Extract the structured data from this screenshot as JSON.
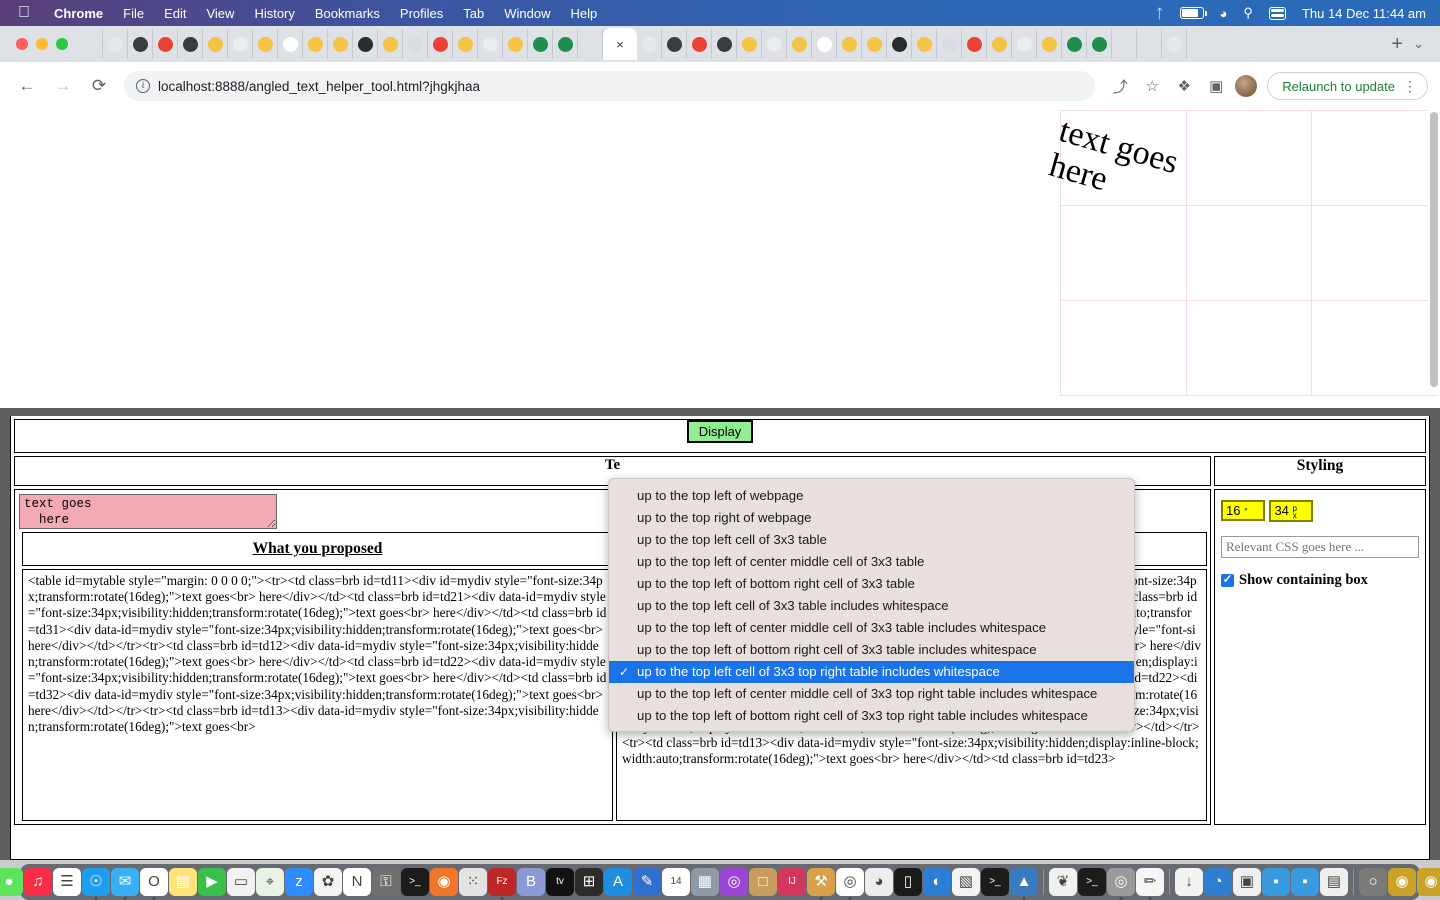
{
  "menubar": {
    "apple_icon": "apple-icon",
    "items": [
      {
        "label": "Chrome",
        "bold": true
      },
      {
        "label": "File",
        "bold": false
      },
      {
        "label": "Edit",
        "bold": false
      },
      {
        "label": "View",
        "bold": false
      },
      {
        "label": "History",
        "bold": false
      },
      {
        "label": "Bookmarks",
        "bold": false
      },
      {
        "label": "Profiles",
        "bold": false
      },
      {
        "label": "Tab",
        "bold": false
      },
      {
        "label": "Window",
        "bold": false
      },
      {
        "label": "Help",
        "bold": false
      }
    ],
    "status_icons": [
      "bluetooth-icon",
      "battery-icon",
      "wifi-icon",
      "search-icon",
      "control-center-icon"
    ],
    "clock": "Thu 14 Dec  11:44 am"
  },
  "browser": {
    "tab_count": 44,
    "active_tab_index": 21,
    "close_label": "×",
    "new_tab_label": "+",
    "tab_list_label": "⌄",
    "back_label": "←",
    "forward_label": "→",
    "reload_label": "⟳",
    "url": "localhost:8888/angled_text_helper_tool.html?jhgkjhaa",
    "url_host": "localhost",
    "url_path": ":8888/angled_text_helper_tool.html?jhgkjhaa",
    "share_label": "⤴",
    "bookmark_label": "☆",
    "extensions_label": "❖",
    "sidepanel_label": "▣",
    "relaunch_label": "Relaunch to update",
    "menu_label": "⋮"
  },
  "page": {
    "rotated_text_line1": "text goes",
    "rotated_text_line2": "here",
    "rotation_deg": 16,
    "font_size_px": 34
  },
  "tool": {
    "display_button": "Display",
    "textarea_value": "text goes\n  here",
    "columns": {
      "proposed": "What you proposed",
      "middle": "Te",
      "styling": "Styling"
    },
    "code_left": "<table id=mytable style=\"margin: 0 0 0 0;\"><tr><td class=brb id=td11><div id=mydiv style=\"font-size:34px;transform:rotate(16deg);\">text goes<br> here</div></td><td class=brb id=td21><div data-id=mydiv style=\"font-size:34px;visibility:hidden;transform:rotate(16deg);\">text goes<br> here</div></td><td class=brb id=td31><div data-id=mydiv style=\"font-size:34px;visibility:hidden;transform:rotate(16deg);\">text goes<br> here</div></td></tr><tr><td class=brb id=td12><div data-id=mydiv style=\"font-size:34px;visibility:hidden;transform:rotate(16deg);\">text goes<br> here</div></td><td class=brb id=td22><div data-id=mydiv style=\"font-size:34px;visibility:hidden;transform:rotate(16deg);\">text goes<br> here</div></td><td class=brb id=td32><div data-id=mydiv style=\"font-size:34px;visibility:hidden;transform:rotate(16deg);\">text goes<br> here</div></td></tr><tr><td class=brb id=td13><div data-id=mydiv style=\"font-size:34px;visibility:hidden;transform:rotate(16deg);\">text goes<br>",
    "code_right": "<table id=mytable style=\"margin: 0 0 0 0;\"><tr><td class=brb id=td11><div id=mydiv style=\"font-size:34px;display:inline-block;width:auto;transform:rotate(16deg);\">text goes<br> here</div></td><td class=brb id=td21><div data-id=mydiv style=\"font-size:34px;visibility:hidden;display:inline-block;width:auto;transform:rotate(16deg);\">text goes<br> here</div></td><td class=brb id=td31><div data-id=mydiv style=\"font-size:34px;visibility:hidden;display:inline-block;width:auto;transform:rotate(16deg);\">text goes<br> here</div></td></tr><tr><td class=brb id=td12><div data-id=mydiv style=\"font-size:34px;visibility:hidden;display:inline-block;width:auto;transform:rotate(16deg);\">text goes<br> here</div></td><td class=brb id=td22><div data-id=mydiv style=\"font-size:34px;visibility:hidden;display:inline-block;width:auto;transform:rotate(16deg);\">text goes<br> here</div></td><td class=brb id=td32><div data-id=mydiv style=\"font-size:34px;visibility:hidden;display:inline-block;width:auto;transform:rotate(16deg);\">text goes<br> here</div></td></tr><tr><td class=brb id=td13><div data-id=mydiv style=\"font-size:34px;visibility:hidden;display:inline-block;width:auto;transform:rotate(16deg);\">text goes<br> here</div></td><td class=brb id=td23>",
    "styling": {
      "angle_value": "16",
      "angle_unit": "°",
      "size_value": "34",
      "size_unit": "px",
      "css_placeholder": "Relevant CSS goes here ...",
      "show_box_label": "Show containing box",
      "show_box_checked": true
    }
  },
  "dropdown": {
    "selected_index": 8,
    "options": [
      "up to the top left of webpage",
      "up to the top right of webpage",
      "up to the top left cell of 3x3 table",
      "up to the top left of center middle cell of 3x3 table",
      "up to the top left of bottom right cell of 3x3 table",
      "up to the top left cell of 3x3 table includes whitespace",
      "up to the top left of center middle cell of 3x3 table includes whitespace",
      "up to the top left of bottom right cell of 3x3 table includes whitespace",
      "up to the top left cell of 3x3 top right table includes whitespace",
      "up to the top left of center middle cell of 3x3 top right table includes whitespace",
      "up to the top left of bottom right cell of 3x3 top right table includes whitespace"
    ]
  },
  "dock": {
    "items": [
      {
        "name": "finder",
        "glyph": "◑",
        "color": "#1f8de0",
        "running": true
      },
      {
        "name": "messages",
        "glyph": "●",
        "color": "#5ee35d",
        "running": false
      },
      {
        "name": "music",
        "glyph": "♫",
        "color": "#fa2d48",
        "running": false
      },
      {
        "name": "reminders",
        "glyph": "☰",
        "color": "#ffffff",
        "running": false
      },
      {
        "name": "safari",
        "glyph": "☉",
        "color": "#1f9ef0",
        "running": true
      },
      {
        "name": "mail",
        "glyph": "✉",
        "color": "#38b0f5",
        "running": true
      },
      {
        "name": "opera",
        "glyph": "O",
        "color": "#ffffff",
        "running": true
      },
      {
        "name": "notes",
        "glyph": "▤",
        "color": "#fee37a",
        "running": false
      },
      {
        "name": "facetime",
        "glyph": "▶",
        "color": "#39c04a",
        "running": false
      },
      {
        "name": "pages",
        "glyph": "▭",
        "color": "#f2f2f2",
        "running": false
      },
      {
        "name": "maps",
        "glyph": "⌖",
        "color": "#e9f3e4",
        "running": false
      },
      {
        "name": "zoom",
        "glyph": "z",
        "color": "#2d8cff",
        "running": false
      },
      {
        "name": "photos",
        "glyph": "✿",
        "color": "#f5f5f5",
        "running": false
      },
      {
        "name": "news",
        "glyph": "N",
        "color": "#ffffff",
        "running": false
      },
      {
        "name": "keychain",
        "glyph": "⚿",
        "color": "#6f6f6f",
        "running": false
      },
      {
        "name": "terminal",
        "glyph": ">_",
        "color": "#1c1c1c",
        "running": false
      },
      {
        "name": "firefox",
        "glyph": "◉",
        "color": "#f0762a",
        "running": false
      },
      {
        "name": "launchpad",
        "glyph": "⁙",
        "color": "#e3e3e3",
        "running": false
      },
      {
        "name": "filezilla",
        "glyph": "Fz",
        "color": "#bf2626",
        "running": true
      },
      {
        "name": "bitwarden",
        "glyph": "B",
        "color": "#8b9ad6",
        "running": false
      },
      {
        "name": "appletv",
        "glyph": "tv",
        "color": "#111111",
        "running": false
      },
      {
        "name": "calculator",
        "glyph": "⊞",
        "color": "#2b2b2b",
        "running": false
      },
      {
        "name": "appstore",
        "glyph": "A",
        "color": "#1f8de0",
        "running": false
      },
      {
        "name": "freeform",
        "glyph": "✎",
        "color": "#2f6fd0",
        "running": false
      },
      {
        "name": "calendar",
        "glyph": "14",
        "color": "#ffffff",
        "running": false
      },
      {
        "name": "news2",
        "glyph": "▦",
        "color": "#8e9aa6",
        "running": false
      },
      {
        "name": "podcasts",
        "glyph": "◎",
        "color": "#9a45d6",
        "running": false
      },
      {
        "name": "books",
        "glyph": "□",
        "color": "#c79c5d",
        "running": false
      },
      {
        "name": "intellij",
        "glyph": "IJ",
        "color": "#d3375d",
        "running": false
      },
      {
        "name": "painter",
        "glyph": "⚒",
        "color": "#d8a24a",
        "running": true
      },
      {
        "name": "chrome",
        "glyph": "◎",
        "color": "#ffffff",
        "running": true
      },
      {
        "name": "gimp",
        "glyph": "◕",
        "color": "#ededed",
        "running": false
      },
      {
        "name": "iphone-mirror",
        "glyph": "▯",
        "color": "#1a1a1a",
        "running": false
      },
      {
        "name": "preview",
        "glyph": "◐",
        "color": "#2a7fd4",
        "running": false
      },
      {
        "name": "textedit",
        "glyph": "▧",
        "color": "#f4f4f4",
        "running": false
      },
      {
        "name": "terminal2",
        "glyph": ">_",
        "color": "#1c1c1c",
        "running": false
      },
      {
        "name": "sourcetree",
        "glyph": "▲",
        "color": "#3a7ac0",
        "running": true
      },
      {
        "name": "tooth",
        "glyph": "❦",
        "color": "#f0f0f0",
        "running": false
      },
      {
        "name": "terminal3",
        "glyph": ">_",
        "color": "#1c1c1c",
        "running": false
      },
      {
        "name": "screenshot",
        "glyph": "◎",
        "color": "#9a9a9a",
        "running": true
      },
      {
        "name": "notes2",
        "glyph": "✏",
        "color": "#f6f6f6",
        "running": true
      },
      {
        "name": "downloads",
        "glyph": "↓",
        "color": "#f2f2f2",
        "running": false
      },
      {
        "name": "globe-doc",
        "glyph": "◔",
        "color": "#2f7fd0",
        "running": false
      },
      {
        "name": "window-doc",
        "glyph": "▣",
        "color": "#f0f0f0",
        "running": false
      },
      {
        "name": "mini1",
        "glyph": "▪",
        "color": "#3a9ae0",
        "running": false
      },
      {
        "name": "mini2",
        "glyph": "▪",
        "color": "#3a9ae0",
        "running": false
      },
      {
        "name": "window-stack",
        "glyph": "▤",
        "color": "#efefef",
        "running": false
      },
      {
        "name": "mini3",
        "glyph": "○",
        "color": "#7a7a7a",
        "running": false
      },
      {
        "name": "mini4",
        "glyph": "◉",
        "color": "#c9a227",
        "running": false
      },
      {
        "name": "mini5",
        "glyph": "◉",
        "color": "#c9a227",
        "running": false
      },
      {
        "name": "trash",
        "glyph": "ᵜ",
        "color": "#dfe4e8",
        "running": false
      }
    ]
  }
}
